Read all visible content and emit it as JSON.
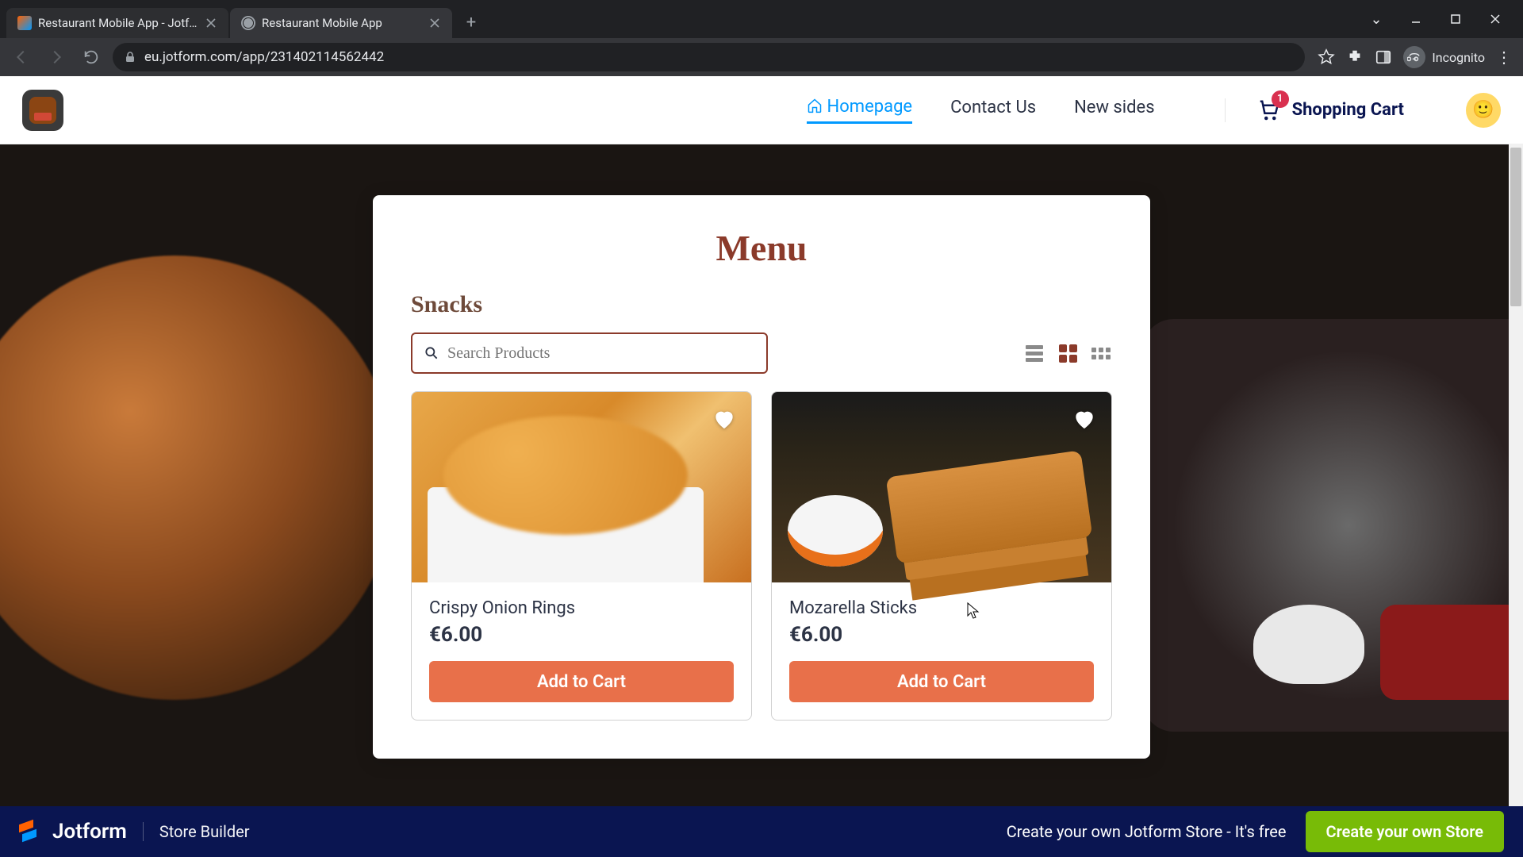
{
  "browser": {
    "tabs": [
      {
        "title": "Restaurant Mobile App - Jotform",
        "active": false
      },
      {
        "title": "Restaurant Mobile App",
        "active": true
      }
    ],
    "url": "eu.jotform.com/app/231402114562442",
    "incognito_label": "Incognito"
  },
  "header": {
    "nav": {
      "homepage": "Homepage",
      "contact": "Contact Us",
      "newsides": "New sides"
    },
    "cart": {
      "label": "Shopping Cart",
      "count": "1"
    }
  },
  "menu": {
    "title": "Menu",
    "category": "Snacks",
    "search_placeholder": "Search Products",
    "add_to_cart": "Add to Cart",
    "products": [
      {
        "name": "Crispy Onion Rings",
        "price": "€6.00"
      },
      {
        "name": "Mozarella Sticks",
        "price": "€6.00"
      }
    ]
  },
  "banner": {
    "brand": "Jotform",
    "sub": "Store Builder",
    "cta_text": "Create your own Jotform Store - It's free",
    "cta_button": "Create your own Store"
  }
}
